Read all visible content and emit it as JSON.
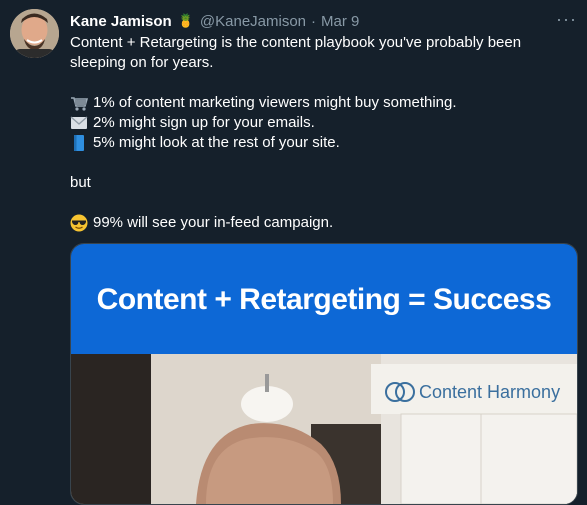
{
  "tweet": {
    "author_name": "Kane Jamison",
    "author_emoji": "🍍",
    "handle": "@KaneJamison",
    "separator": "·",
    "date": "Mar 9",
    "more_label": "···",
    "lines": {
      "intro": "Content + Retargeting is the content playbook you've probably been sleeping on for years.",
      "buy": "1% of content marketing viewers might buy something.",
      "emails": "2% might sign up for your emails.",
      "site": "5% might look at the rest of your site.",
      "but": "but",
      "campaign": "99% will see your in-feed campaign."
    },
    "icons": {
      "buy": "shopping-cart-icon",
      "emails": "envelope-icon",
      "site": "blue-book-icon",
      "campaign": "sunglasses-face-icon"
    }
  },
  "media": {
    "banner_title": "Content + Retargeting = Success",
    "brand_name": "Content Harmony",
    "banner_color": "#0d68d6"
  }
}
